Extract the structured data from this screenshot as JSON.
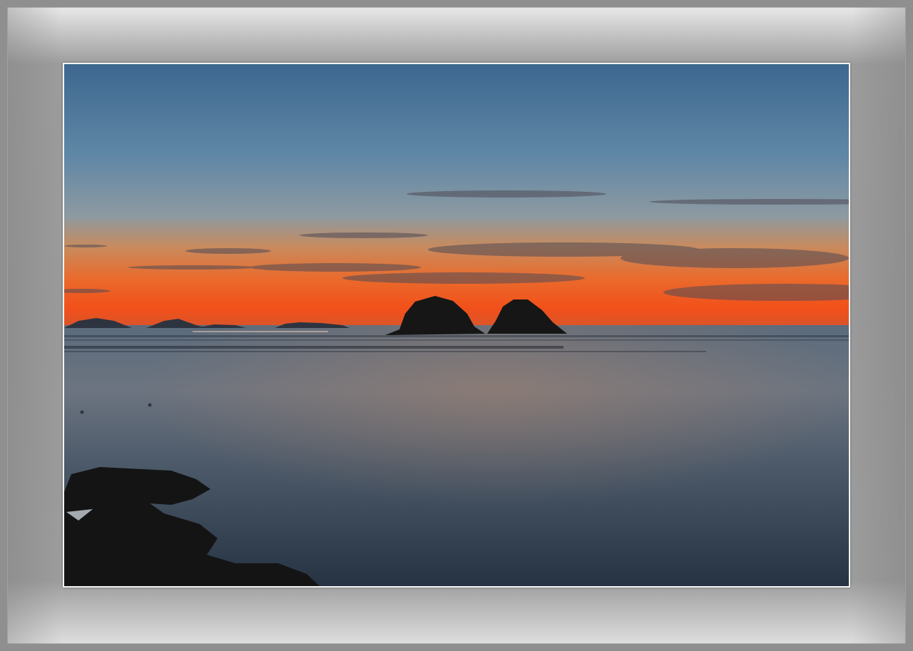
{
  "image": {
    "subject": "sunset-seascape",
    "colors": {
      "sky_top": "#3f6a93",
      "sky_mid": "#7c93a6",
      "horizon_glow": "#f0561d",
      "sea": "#3d4d5e",
      "silhouette": "#151515",
      "frame": "#9a9a9a"
    }
  }
}
